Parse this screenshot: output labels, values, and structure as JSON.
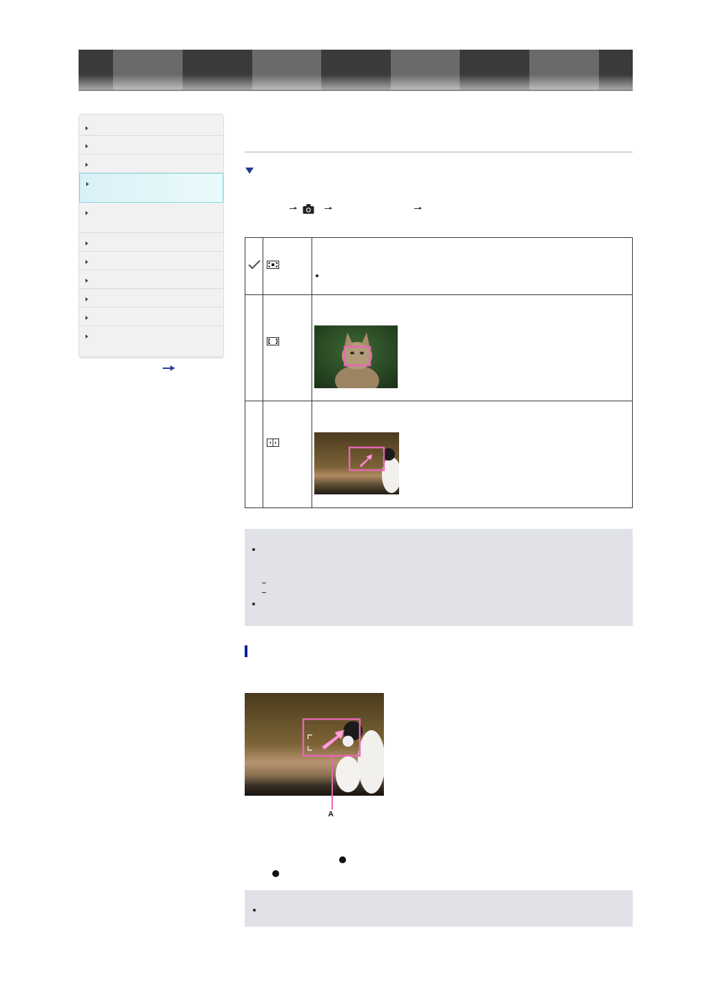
{
  "header": {
    "tabs": [
      {
        "label": "",
        "color": "#3a3a3a"
      },
      {
        "label": "",
        "color": "#6a6a6a"
      },
      {
        "label": "",
        "color": "#3a3a3a"
      },
      {
        "label": "",
        "color": "#6a6a6a"
      },
      {
        "label": "",
        "color": "#3a3a3a"
      },
      {
        "label": "",
        "color": "#6a6a6a"
      },
      {
        "label": "",
        "color": "#3a3a3a"
      },
      {
        "label": "",
        "color": "#6a6a6a"
      },
      {
        "label": "",
        "color": "#3a3a3a"
      }
    ]
  },
  "sidebar": {
    "items": [
      {
        "label": "",
        "active": false
      },
      {
        "label": "",
        "active": false
      },
      {
        "label": "",
        "active": false
      },
      {
        "label": "",
        "active": true
      },
      {
        "label": "",
        "active": false
      },
      {
        "label": "",
        "active": false
      },
      {
        "label": "",
        "active": false
      },
      {
        "label": "",
        "active": false
      },
      {
        "label": "",
        "active": false
      },
      {
        "label": "",
        "active": false
      },
      {
        "label": "",
        "active": false
      }
    ],
    "more_icon": "right-arrow-icon"
  },
  "main": {
    "title": "",
    "section_marker_icon": "triangle-down-icon",
    "menu_path": {
      "camera_icon": "camera-icon",
      "arrow_icon": "right-arrow-icon"
    },
    "options": [
      {
        "selected": true,
        "icon": "wide-af-area-icon",
        "description": "",
        "note": ""
      },
      {
        "selected": false,
        "icon": "center-af-area-icon",
        "description": "",
        "image": "cat-face-focus-photo"
      },
      {
        "selected": false,
        "icon": "flexible-spot-af-icon",
        "description": "",
        "image": "cat-flexible-spot-photo"
      }
    ],
    "checkmark_icon": "checkmark-icon"
  },
  "notes": {
    "first": {
      "bullets": [
        "",
        ""
      ],
      "dashes": [
        "",
        ""
      ]
    },
    "second": {
      "bullets": [
        ""
      ]
    }
  },
  "subsection": {
    "marker_color": "#0a1f8f",
    "image": "cat-flexible-spot-large-photo",
    "callout_label": "A"
  },
  "colors": {
    "accent": "#233a8c",
    "active_sidebar": "#8ed4e2",
    "note_bg": "#e0e2e8",
    "focus_frame": "#e668b4"
  }
}
